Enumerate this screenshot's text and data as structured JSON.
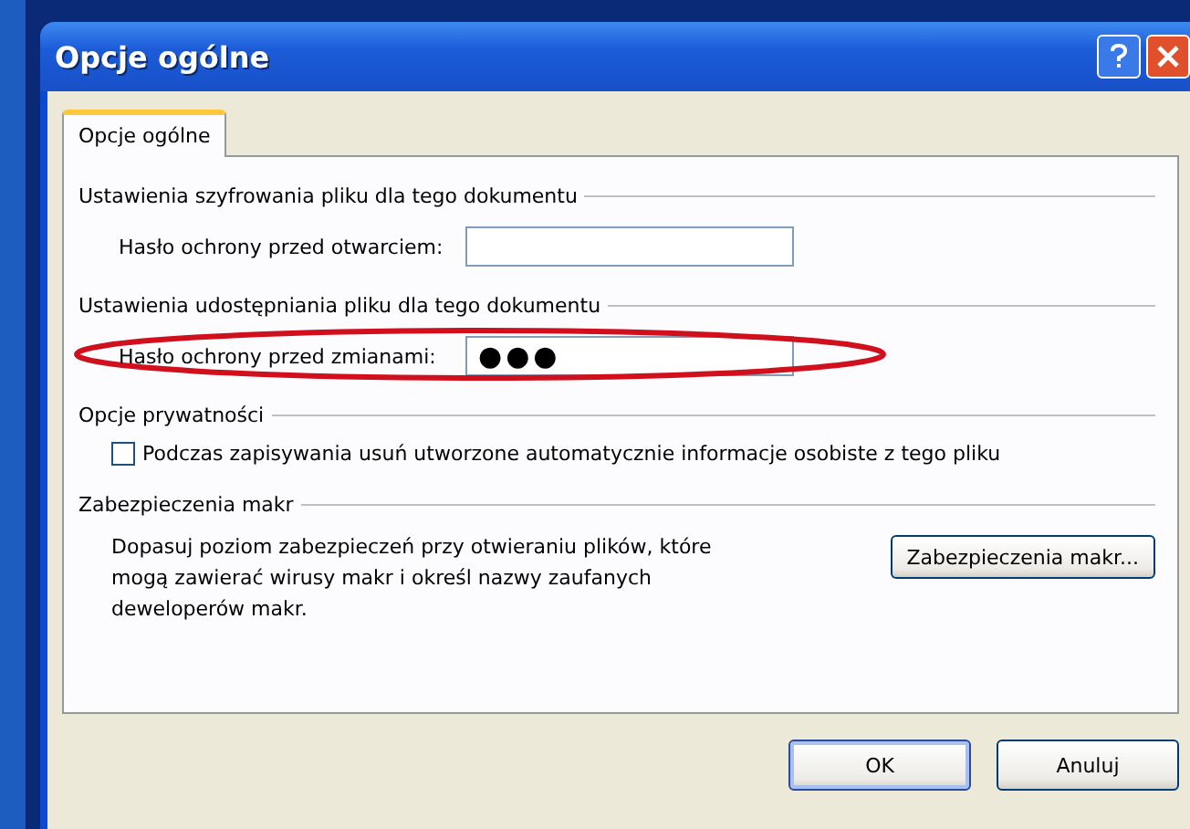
{
  "window": {
    "title": "Opcje ogólne"
  },
  "tabs": [
    {
      "label": "Opcje ogólne",
      "selected": true
    }
  ],
  "sections": [
    {
      "kind": "field",
      "heading": "Ustawienia szyfrowania pliku dla tego dokumentu",
      "label": "Hasło ochrony przed otwarciem:",
      "highlighted": false
    },
    {
      "kind": "field",
      "heading": "Ustawienia udostępniania pliku dla tego dokumentu",
      "label": "Hasło ochrony przed zmianami:",
      "value": "●●●",
      "highlighted": true
    },
    {
      "kind": "checkbox",
      "heading": "Opcje prywatności",
      "label": "Podczas zapisywania usuń utworzone automatycznie informacje osobiste z tego pliku",
      "checked": false
    },
    {
      "kind": "macro",
      "heading": "Zabezpieczenia makr",
      "text": "Dopasuj poziom zabezpieczeń przy otwieraniu plików, które mogą zawierać wirusy makr i określ nazwy zaufanych deweloperów makr.",
      "button": "Zabezpieczenia makr..."
    }
  ],
  "buttons": [
    {
      "label": "OK",
      "default": true
    },
    {
      "label": "Anuluj",
      "default": false
    }
  ]
}
